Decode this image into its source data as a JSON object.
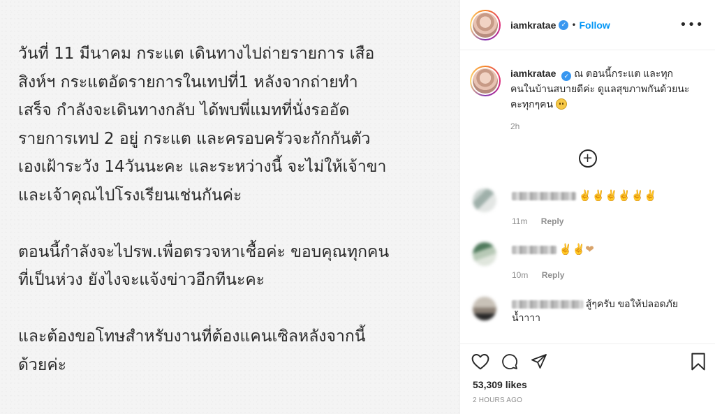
{
  "post_image": {
    "paragraphs": [
      "วันที่ 11 มีนาคม กระแต เดินทางไปถ่ายรายการ เสือ\nสิงห์ฯ  กระแตอัดรายการในเทปที่1 หลังจากถ่ายทำ\nเสร็จ กำลังจะเดินทางกลับ ได้พบพี่แมทที่นั่งรออัด\nรายการเทป 2 อยู่  กระแต และครอบครัวจะกักกันตัว\nเองเฝ้าระวัง 14วันนะคะ และระหว่างนี้ จะไม่ให้เจ้าขา\nและเจ้าคุณไปโรงเรียนเช่นกันค่ะ",
      "ตอนนี้กำลังจะไปรพ.เพื่อตรวจหาเชื้อค่ะ ขอบคุณทุกคน\nที่เป็นห่วง ยังไงจะแจ้งข่าวอีกทีนะคะ",
      "และต้องขอโทษสำหรับงานที่ต้องแคนเซิลหลังจากนี้\nด้วยค่ะ"
    ]
  },
  "header": {
    "username": "iamkratae",
    "dot": "•",
    "follow_label": "Follow",
    "more_label": "•••"
  },
  "caption": {
    "username": "iamkratae",
    "text": "ณ ตอนนี้กระแต และทุก คนในบ้านสบายดีค่ะ ดูแลสุขภาพกันด้วยนะ คะทุกๆคน",
    "time": "2h"
  },
  "load_more": {
    "icon": "plus-circle-icon",
    "label": "+"
  },
  "comments": [
    {
      "emoji": "✌✌✌✌✌✌",
      "time": "11m",
      "reply_label": "Reply"
    },
    {
      "emoji": "✌✌❤",
      "time": "10m",
      "reply_label": "Reply"
    },
    {
      "text": "สู้ๆครับ ขอให้ปลอดภัย น้ำาาา",
      "time": "",
      "reply_label": ""
    }
  ],
  "actions": {
    "likes": "53,309 likes",
    "posted_ago": "2 HOURS AGO",
    "icons": [
      "heart-icon",
      "comment-icon",
      "share-icon",
      "bookmark-icon"
    ]
  },
  "colors": {
    "link_blue": "#0095f6",
    "verified_blue": "#3897f0",
    "muted": "#8e8e8e",
    "text": "#262626"
  }
}
